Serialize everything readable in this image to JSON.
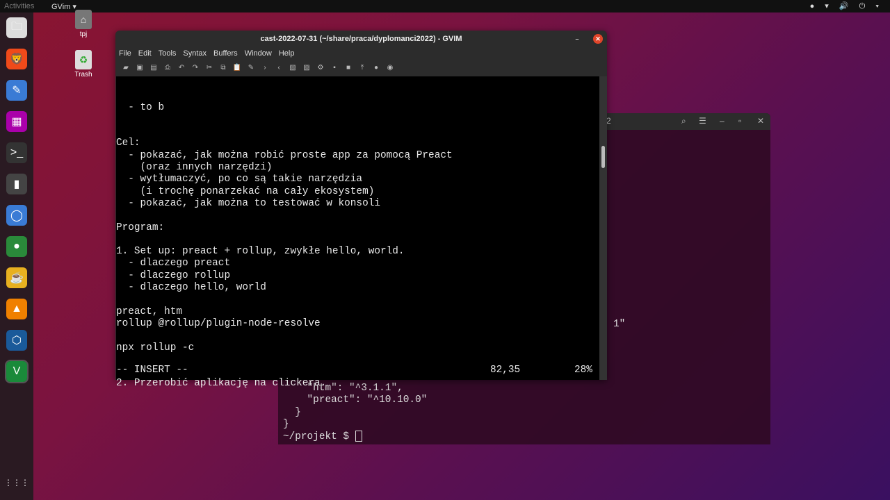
{
  "topbar": {
    "activities": "Activities",
    "app": "GVim ▾",
    "tray": "● ▾ 🔊 ⏻ ▾"
  },
  "dock": [
    {
      "name": "files-icon",
      "g": "🗀",
      "c": "#ddd"
    },
    {
      "name": "brave-icon",
      "g": "🦁",
      "c": "#f04a1a"
    },
    {
      "name": "text-editor-icon",
      "g": "✎",
      "c": "#3a7bd5"
    },
    {
      "name": "video-icon",
      "g": "▦",
      "c": "#a0a"
    },
    {
      "name": "terminal-icon",
      "g": ">_",
      "c": "#333"
    },
    {
      "name": "kdenlive-icon",
      "g": "▮",
      "c": "#444"
    },
    {
      "name": "chromium-icon",
      "g": "◯",
      "c": "#3a7bd5"
    },
    {
      "name": "globe-icon",
      "g": "●",
      "c": "#2a8a3a"
    },
    {
      "name": "teapot-icon",
      "g": "☕",
      "c": "#e8b020"
    },
    {
      "name": "vlc-icon",
      "g": "▲",
      "c": "#f08000"
    },
    {
      "name": "virtualbox-icon",
      "g": "⬡",
      "c": "#1a5a9a"
    },
    {
      "name": "gvim-icon",
      "g": "V",
      "c": "#1a8a3a"
    }
  ],
  "apps_grid": "⋮⋮⋮",
  "desktop": {
    "home": "tpj",
    "trash": "Trash"
  },
  "terminal": {
    "title_frag": "2",
    "lines": [
      "    \"htm\": \"^3.1.1\",",
      "    \"preact\": \"^10.10.0\"",
      "  }",
      "}"
    ],
    "prompt": "~/projekt $ ",
    "frag": "1\""
  },
  "gvim": {
    "title": "cast-2022-07-31 (~/share/praca/dyplomanci2022) - GVIM",
    "menu": [
      "File",
      "Edit",
      "Tools",
      "Syntax",
      "Buffers",
      "Window",
      "Help"
    ],
    "lines": [
      "  - to b",
      "",
      "",
      "Cel:",
      "  - pokazać, jak można robić proste app za pomocą Preact",
      "    (oraz innych narzędzi)",
      "  - wytłumaczyć, po co są takie narzędzia",
      "    (i trochę ponarzekać na cały ekosystem)",
      "  - pokazać, jak można to testować w konsoli",
      "",
      "Program:",
      "",
      "1. Set up: preact + rollup, zwykłe hello, world.",
      "  - dlaczego preact",
      "  - dlaczego rollup",
      "  - dlaczego hello, world",
      "",
      "preact, htm",
      "rollup @rollup/plugin-node-resolve",
      "",
      "npx rollup -c",
      "",
      "",
      "2. Przerobić aplikację na clickera."
    ],
    "mode": "-- INSERT --",
    "position": "82,35",
    "percent": "28%"
  }
}
